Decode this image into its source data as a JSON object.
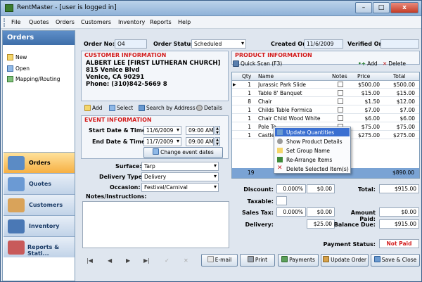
{
  "window": {
    "title": "RentMaster - [user is logged in]",
    "min": "–",
    "max": "□",
    "close": "x"
  },
  "menu": [
    "File",
    "Quotes",
    "Orders",
    "Customers",
    "Inventory",
    "Reports",
    "Help"
  ],
  "left": {
    "header": "Orders",
    "items": [
      "New",
      "Open",
      "Mapping/Routing"
    ],
    "nav": [
      "Orders",
      "Quotes",
      "Customers",
      "Inventory",
      "Reports & Stati..."
    ]
  },
  "order": {
    "order_no_label": "Order No:",
    "order_no": "O4",
    "status_label": "Order Status:",
    "status": "Scheduled",
    "created_label": "Created On:",
    "created": "11/6/2009",
    "verified_label": "Verified On:",
    "verified": ""
  },
  "customer": {
    "title": "CUSTOMER INFORMATION",
    "lines": [
      "ALBERT LEE [FIRST LUTHERAN CHURCH]",
      "815 Venice Blvd",
      "Venice, CA 90291",
      "Phone: (310)842-5669 8"
    ],
    "add": "Add",
    "select": "Select",
    "search": "Search by Address",
    "details": "Details"
  },
  "event": {
    "title": "EVENT INFORMATION",
    "start_label": "Start Date & Time:",
    "start_date": "11/6/2009",
    "start_time": "09:00 AM",
    "end_label": "End Date & Time:",
    "end_date": "11/7/2009",
    "end_time": "09:00 AM",
    "change_btn": "Change event dates",
    "surface_label": "Surface:",
    "surface": "Tarp",
    "delivery_label": "Delivery Type:",
    "delivery": "Delivery",
    "occasion_label": "Occasion:",
    "occasion": "Festival/Carnival",
    "notes_label": "Notes/Instructions:"
  },
  "product": {
    "title": "PRODUCT INFORMATION",
    "quick_scan": "Quick Scan (F3)",
    "add": "Add",
    "delete": "Delete",
    "columns": [
      "Qty",
      "Name",
      "Notes",
      "Price",
      "Total"
    ],
    "rows": [
      {
        "qty": "1",
        "name": "Jurassic Park Slide",
        "price": "$500.00",
        "total": "$500.00"
      },
      {
        "qty": "1",
        "name": "Table 8' Banquet",
        "price": "$15.00",
        "total": "$15.00"
      },
      {
        "qty": "8",
        "name": "Chair",
        "price": "$1.50",
        "total": "$12.00"
      },
      {
        "qty": "1",
        "name": "Childs Table Formica",
        "price": "$7.00",
        "total": "$7.00"
      },
      {
        "qty": "1",
        "name": "Chair Child Wood White",
        "price": "$6.00",
        "total": "$6.00"
      },
      {
        "qty": "1",
        "name": "Pole Te",
        "price": "$75.00",
        "total": "$75.00"
      },
      {
        "qty": "1",
        "name": "Castle M",
        "price": "$275.00",
        "total": "$275.00"
      }
    ],
    "footer_qty": "19",
    "footer_total": "$890.00"
  },
  "context_menu": [
    "Update Quantities",
    "Show Product Details",
    "Set Group Name",
    "Re-Arrange Items",
    "Delete Selected Item(s)"
  ],
  "totals": {
    "discount_label": "Discount:",
    "discount_pct": "0.000%",
    "discount": "$0.00",
    "taxable_label": "Taxable:",
    "salestax_label": "Sales Tax:",
    "salestax_pct": "0.000%",
    "salestax": "$0.00",
    "delivery_label": "Delivery:",
    "delivery": "$25.00",
    "total_label": "Total:",
    "total": "$915.00",
    "paid_label": "Amount Paid:",
    "paid": "$0.00",
    "balance_label": "Balance Due:",
    "balance": "$915.00",
    "payment_status_label": "Payment Status:",
    "payment_status": "Not Paid"
  },
  "actions": {
    "email": "E-mail",
    "print": "Print",
    "payments": "Payments",
    "update": "Update Order",
    "save": "Save & Close"
  }
}
